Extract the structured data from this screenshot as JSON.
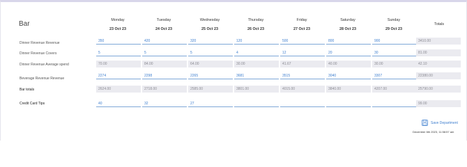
{
  "page": {
    "title": "Bar",
    "totals_header": "Totals"
  },
  "days": [
    {
      "name": "Monday",
      "date": "23 Oct 23"
    },
    {
      "name": "Tuesday",
      "date": "24 Oct 23"
    },
    {
      "name": "Wednesday",
      "date": "25 Oct 23"
    },
    {
      "name": "Thursday",
      "date": "26 Oct 23"
    },
    {
      "name": "Friday",
      "date": "27 Oct 23"
    },
    {
      "name": "Saturday",
      "date": "28 Oct 23"
    },
    {
      "name": "Sunday",
      "date": "29 Oct 23"
    }
  ],
  "rows": [
    {
      "label": "Dinner Revenue Revenue",
      "editable": true,
      "values": [
        "350",
        "420",
        "320",
        "120",
        "500",
        "800",
        "900"
      ],
      "total": "3410.00"
    },
    {
      "label": "Dinner Revenue Covers",
      "editable": true,
      "values": [
        "5",
        "5",
        "5",
        "4",
        "12",
        "20",
        "30"
      ],
      "total": "81.00"
    },
    {
      "label": "Dinner Revenue Average spend",
      "editable": false,
      "values": [
        "70.00",
        "84.00",
        "64.00",
        "30.00",
        "41.67",
        "40.00",
        "30.00"
      ],
      "total": "42.10"
    },
    {
      "label": "Beverage Revenue Revenue",
      "editable": true,
      "values": [
        "2274",
        "2298",
        "2265",
        "3681",
        "3515",
        "3040",
        "3307"
      ],
      "total": "22380.00"
    },
    {
      "label": "Bar totals",
      "editable": false,
      "values": [
        "2624.00",
        "2718.00",
        "2585.00",
        "3801.00",
        "4015.00",
        "3840.00",
        "4207.00"
      ],
      "total": "25790.00"
    },
    {
      "label": "Credit Card Tips",
      "editable": true,
      "values": [
        "40",
        "32",
        "27",
        "",
        "",
        "",
        ""
      ],
      "total": "99.00"
    }
  ],
  "footer": {
    "save_label": "Save Department",
    "timestamp": "December 6th 2023, 11:58:57 am"
  },
  "colors": {
    "accent": "#3f7fcf",
    "readonly_bg": "#ebebf0"
  },
  "icons": {
    "save": "floppy-disk-icon"
  }
}
